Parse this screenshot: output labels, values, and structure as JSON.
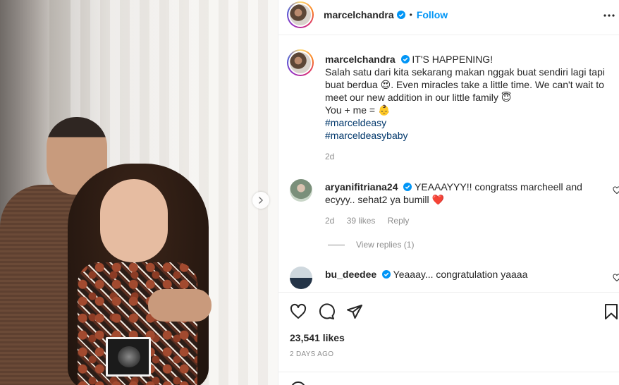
{
  "post_author": {
    "username": "marcelchandra",
    "follow_label": "Follow",
    "separator": "•"
  },
  "caption": {
    "username": "marcelchandra",
    "lines": [
      "IT'S HAPPENING!",
      "Salah satu dari kita sekarang makan nggak buat sendiri lagi tapi buat berdua 😍. Even miracles take a little time. We can't wait to meet our new addition in our little family 😇",
      "You + me = 👶"
    ],
    "hashtags": [
      "#marceldeasy",
      "#marceldeasybaby"
    ],
    "time": "2d"
  },
  "comments": [
    {
      "username": "aryanifitriana24",
      "text": "YEAAAYYY!! congratss marcheell and ecyyy.. sehat2 ya bumill ❤️",
      "time": "2d",
      "likes": "39 likes",
      "reply_label": "Reply",
      "view_replies": "View replies (1)"
    },
    {
      "username": "bu_deedee",
      "text": "Yeaaay... congratulation yaaaa"
    }
  ],
  "stats": {
    "likes": "23,541 likes",
    "posted": "2 DAYS AGO"
  },
  "icons": {
    "verified": "verified-badge-icon",
    "more": "more-options-icon",
    "like": "heart-icon",
    "comment": "comment-icon",
    "share": "share-icon",
    "save": "bookmark-icon",
    "next": "chevron-right-icon"
  },
  "colors": {
    "link": "#0095f6",
    "hashtag": "#00376b",
    "muted": "#8e8e8e",
    "heart_red": "#ed4956"
  }
}
